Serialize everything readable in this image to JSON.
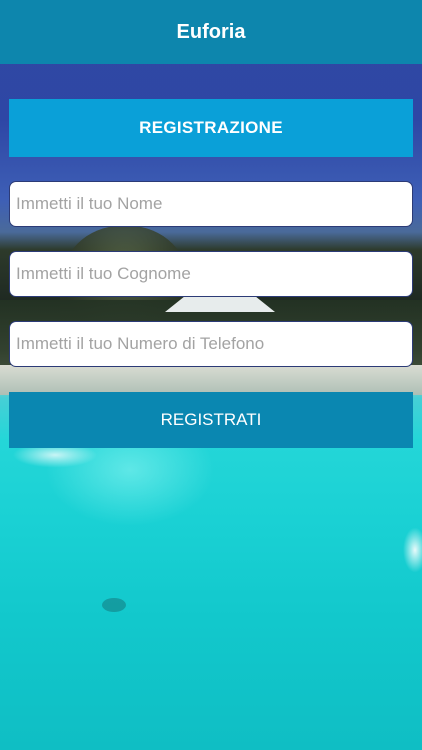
{
  "app_bar": {
    "title": "Euforia"
  },
  "form": {
    "header": "REGISTRAZIONE",
    "name_placeholder": "Immetti il tuo Nome",
    "surname_placeholder": "Immetti il tuo Cognome",
    "phone_placeholder": "Immetti il tuo Numero di Telefono",
    "submit_label": "REGISTRATI"
  },
  "colors": {
    "app_bar": "#0d86ad",
    "header_banner": "#0aa0d8",
    "submit_button": "#0a87b1",
    "field_border": "#2c3b77"
  }
}
